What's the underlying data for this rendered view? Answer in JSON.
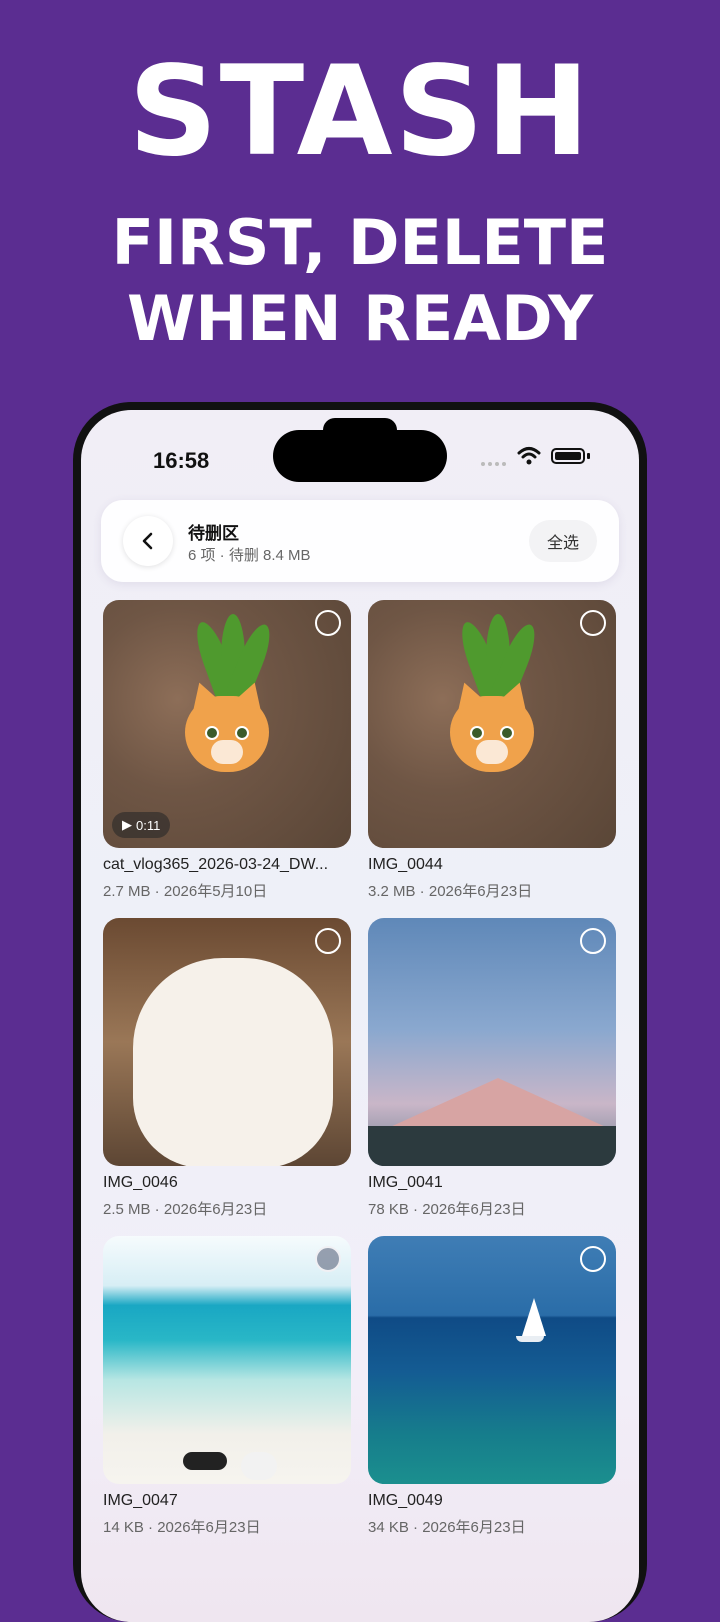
{
  "promo": {
    "line1": "STASH",
    "line2": "FIRST, DELETE",
    "line3": "WHEN READY"
  },
  "status_bar": {
    "time": "16:58"
  },
  "header": {
    "title": "待删区",
    "subtitle": "6 项 · 待删 8.4 MB",
    "select_all_label": "全选"
  },
  "items": [
    {
      "name": "cat_vlog365_2026-03-24_DW...",
      "meta": "2.7 MB · 2026年5月10日",
      "duration": "0:11",
      "selected": false
    },
    {
      "name": "IMG_0044",
      "meta": "3.2 MB · 2026年6月23日",
      "selected": false
    },
    {
      "name": "IMG_0046",
      "meta": "2.5 MB · 2026年6月23日",
      "selected": false
    },
    {
      "name": "IMG_0041",
      "meta": "78 KB · 2026年6月23日",
      "selected": false
    },
    {
      "name": "IMG_0047",
      "meta": "14 KB · 2026年6月23日",
      "selected": false
    },
    {
      "name": "IMG_0049",
      "meta": "34 KB · 2026年6月23日",
      "selected": false
    }
  ],
  "colors": {
    "background": "#5b2d91",
    "headline": "#ffffff"
  }
}
